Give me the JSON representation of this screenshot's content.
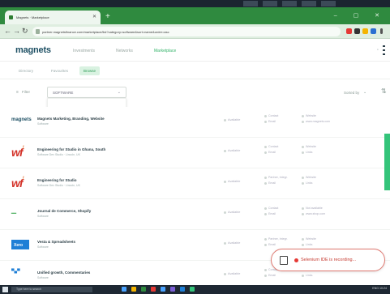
{
  "browser": {
    "tab_title": "Magnets · Marketplace",
    "url": "partner.magnetsfinance.com/marketplace/list?category=software&sort=name&order=asc",
    "new_tab_symbol": "+",
    "window_controls": "– ▢ ✕"
  },
  "header": {
    "logo": "magnets",
    "nav": [
      "Investments",
      "Networks",
      "Marketplace"
    ],
    "active_nav_index": 2
  },
  "subtabs": {
    "items": [
      "Directory",
      "Favourites",
      "Browse"
    ],
    "active_index": 2
  },
  "filter": {
    "filter_label": "Filter",
    "category_value": "SOFTWARE",
    "sort_label": "Sorted by"
  },
  "rows": [
    {
      "logo": "magnets",
      "logo_kind": "magnets",
      "name": "Magnets Marketing, Branding, Website",
      "sub": "Software",
      "col1": "Available",
      "col2a": "Contact",
      "col2b": "Email",
      "col3a": "Website",
      "col3b": "www.magnets.com"
    },
    {
      "logo": "wf",
      "logo_kind": "wf",
      "name": "Engineering for Studio in Ghana, South",
      "sub": "Software Dev Studio · Lincoln, UK",
      "col1": "Available",
      "col2a": "Contact",
      "col2b": "Email",
      "col3a": "Website",
      "col3b": "Links"
    },
    {
      "logo": "wf",
      "logo_kind": "wf",
      "name": "Engineering for Studio",
      "sub": "Software Dev Studio · Lincoln, UK",
      "col1": "Available",
      "col2a": "Partner, Integr.",
      "col2b": "Email",
      "col3a": "Website",
      "col3b": "Links"
    },
    {
      "logo": "dash",
      "logo_kind": "dash",
      "name": "Journal de Commerce, Shopify",
      "sub": "Software",
      "col1": "Available",
      "col2a": "Contact",
      "col2b": "Email",
      "col3a": "Not available",
      "col3b": "www.shop.com"
    },
    {
      "logo": "Xero",
      "logo_kind": "box",
      "name": "Vesta & Spreadsheets",
      "sub": "Software",
      "col1": "Available",
      "col2a": "Partner, Integr.",
      "col2b": "Email",
      "col3a": "Website",
      "col3b": "Links"
    },
    {
      "logo": "ribbon",
      "logo_kind": "ribbon",
      "name": "Unified growth, Commentaries",
      "sub": "Software",
      "col1": "Available",
      "col2a": "Contact",
      "col2b": "Email",
      "col3a": "Website",
      "col3b": "Links"
    }
  ],
  "recording": {
    "text": "Selenium IDE is recording..."
  },
  "taskbar": {
    "search_placeholder": "Type here to search",
    "tray_text": "ENG 10:24"
  },
  "colors": {
    "accent": "#34b36a",
    "brand": "#1d4f63",
    "tab_bar": "#2f8a3f",
    "record_red": "#e53935"
  }
}
